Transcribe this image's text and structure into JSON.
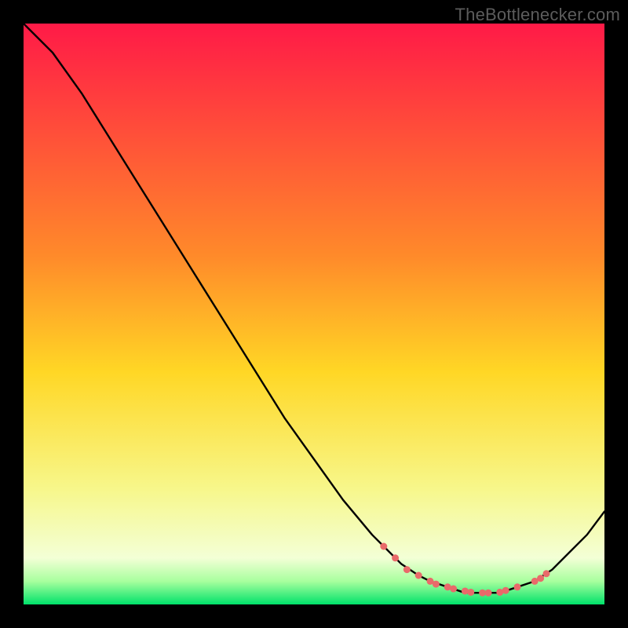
{
  "watermark": "TheBottlenecker.com",
  "chart_data": {
    "type": "line",
    "title": "",
    "xlabel": "",
    "ylabel": "",
    "xlim": [
      0,
      100
    ],
    "ylim": [
      0,
      100
    ],
    "gradient_stops": [
      {
        "offset": 0,
        "color": "#ff1a47"
      },
      {
        "offset": 40,
        "color": "#ff8a2a"
      },
      {
        "offset": 60,
        "color": "#ffd725"
      },
      {
        "offset": 80,
        "color": "#f7f78a"
      },
      {
        "offset": 92,
        "color": "#f3ffd6"
      },
      {
        "offset": 96,
        "color": "#a8ff9e"
      },
      {
        "offset": 100,
        "color": "#00e26a"
      }
    ],
    "series": [
      {
        "name": "bottleneck-curve",
        "x": [
          0,
          5,
          10,
          15,
          20,
          25,
          30,
          35,
          40,
          45,
          50,
          55,
          60,
          62,
          65,
          68,
          70,
          73,
          76,
          79,
          82,
          85,
          88,
          91,
          94,
          97,
          100
        ],
        "y": [
          100,
          95,
          88,
          80,
          72,
          64,
          56,
          48,
          40,
          32,
          25,
          18,
          12,
          10,
          7,
          5,
          4,
          3,
          2,
          2,
          2,
          3,
          4,
          6,
          9,
          12,
          16
        ]
      }
    ],
    "markers": {
      "name": "highlight-dots",
      "color": "#e96a6a",
      "radius": 4.5,
      "points": [
        {
          "x": 62,
          "y": 10
        },
        {
          "x": 64,
          "y": 8
        },
        {
          "x": 66,
          "y": 6
        },
        {
          "x": 68,
          "y": 5
        },
        {
          "x": 70,
          "y": 4
        },
        {
          "x": 71,
          "y": 3.5
        },
        {
          "x": 73,
          "y": 3
        },
        {
          "x": 74,
          "y": 2.7
        },
        {
          "x": 76,
          "y": 2.3
        },
        {
          "x": 77,
          "y": 2.1
        },
        {
          "x": 79,
          "y": 2
        },
        {
          "x": 80,
          "y": 2
        },
        {
          "x": 82,
          "y": 2.1
        },
        {
          "x": 83,
          "y": 2.4
        },
        {
          "x": 85,
          "y": 3
        },
        {
          "x": 88,
          "y": 4
        },
        {
          "x": 89,
          "y": 4.5
        },
        {
          "x": 90,
          "y": 5.3
        }
      ]
    }
  }
}
